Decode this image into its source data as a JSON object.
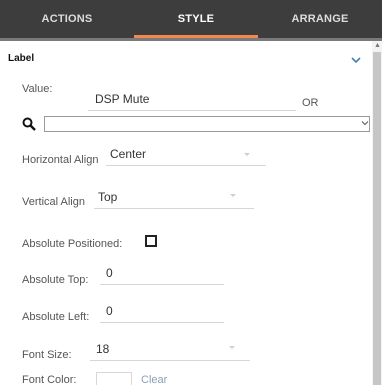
{
  "tabs": [
    {
      "label": "ACTIONS",
      "active": false
    },
    {
      "label": "STYLE",
      "active": true
    },
    {
      "label": "ARRANGE",
      "active": false
    }
  ],
  "accent_color": "#f08a52",
  "section": {
    "title": "Label",
    "collapse_icon": "chevron-down-icon"
  },
  "value_field": {
    "label": "Value:",
    "value": "DSP Mute",
    "or_text": "OR"
  },
  "search": {
    "icon": "search-icon",
    "value": ""
  },
  "horizontal_align": {
    "label": "Horizontal Align",
    "value": "Center"
  },
  "vertical_align": {
    "label": "Vertical Align",
    "value": "Top"
  },
  "absolute_positioned": {
    "label": "Absolute Positioned:",
    "checked": false
  },
  "absolute_top": {
    "label": "Absolute Top:",
    "value": "0"
  },
  "absolute_left": {
    "label": "Absolute Left:",
    "value": "0"
  },
  "font_size": {
    "label": "Font Size:",
    "value": "18"
  },
  "font_color": {
    "label": "Font Color:",
    "clear_label": "Clear"
  }
}
